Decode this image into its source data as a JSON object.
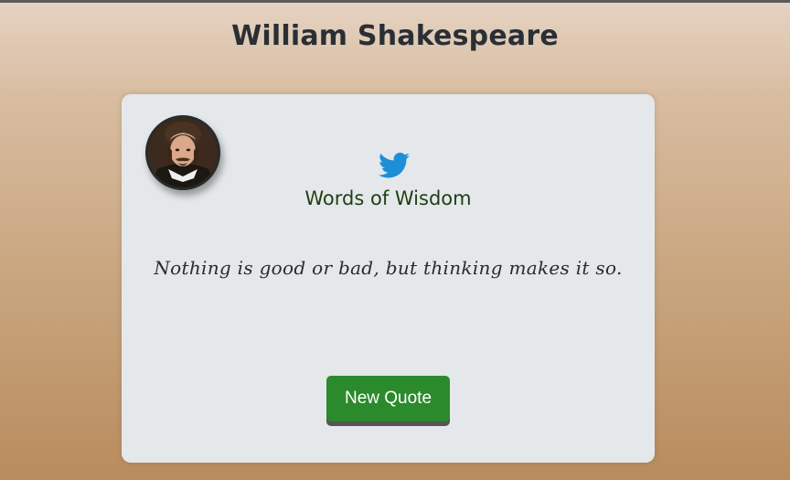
{
  "header": {
    "title": "William Shakespeare"
  },
  "card": {
    "avatar_icon": "portrait-avatar",
    "share_icon": "twitter-bird-icon",
    "heading": "Words of Wisdom",
    "quote": "Nothing is good or bad, but thinking makes it so.",
    "button_label": "New Quote"
  },
  "colors": {
    "background_top": "#e6d3c3",
    "background_bottom": "#b88c5e",
    "card_background": "#e4e8ea",
    "heading": "#1f3f12",
    "twitter_blue": "#1d8fd6",
    "button_green": "#2b8a2b"
  }
}
